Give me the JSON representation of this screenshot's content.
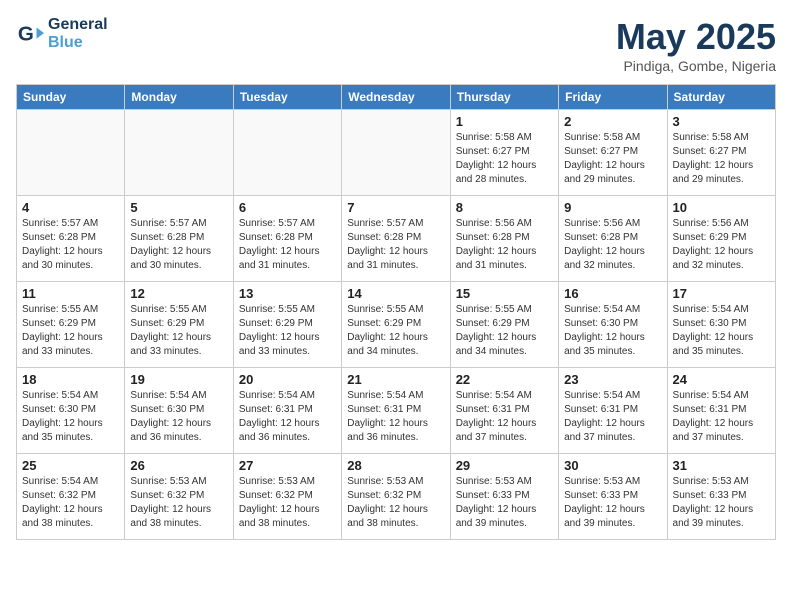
{
  "logo": {
    "line1": "General",
    "line2": "Blue"
  },
  "title": "May 2025",
  "location": "Pindiga, Gombe, Nigeria",
  "weekdays": [
    "Sunday",
    "Monday",
    "Tuesday",
    "Wednesday",
    "Thursday",
    "Friday",
    "Saturday"
  ],
  "weeks": [
    [
      {
        "day": "",
        "info": ""
      },
      {
        "day": "",
        "info": ""
      },
      {
        "day": "",
        "info": ""
      },
      {
        "day": "",
        "info": ""
      },
      {
        "day": "1",
        "info": "Sunrise: 5:58 AM\nSunset: 6:27 PM\nDaylight: 12 hours\nand 28 minutes."
      },
      {
        "day": "2",
        "info": "Sunrise: 5:58 AM\nSunset: 6:27 PM\nDaylight: 12 hours\nand 29 minutes."
      },
      {
        "day": "3",
        "info": "Sunrise: 5:58 AM\nSunset: 6:27 PM\nDaylight: 12 hours\nand 29 minutes."
      }
    ],
    [
      {
        "day": "4",
        "info": "Sunrise: 5:57 AM\nSunset: 6:28 PM\nDaylight: 12 hours\nand 30 minutes."
      },
      {
        "day": "5",
        "info": "Sunrise: 5:57 AM\nSunset: 6:28 PM\nDaylight: 12 hours\nand 30 minutes."
      },
      {
        "day": "6",
        "info": "Sunrise: 5:57 AM\nSunset: 6:28 PM\nDaylight: 12 hours\nand 31 minutes."
      },
      {
        "day": "7",
        "info": "Sunrise: 5:57 AM\nSunset: 6:28 PM\nDaylight: 12 hours\nand 31 minutes."
      },
      {
        "day": "8",
        "info": "Sunrise: 5:56 AM\nSunset: 6:28 PM\nDaylight: 12 hours\nand 31 minutes."
      },
      {
        "day": "9",
        "info": "Sunrise: 5:56 AM\nSunset: 6:28 PM\nDaylight: 12 hours\nand 32 minutes."
      },
      {
        "day": "10",
        "info": "Sunrise: 5:56 AM\nSunset: 6:29 PM\nDaylight: 12 hours\nand 32 minutes."
      }
    ],
    [
      {
        "day": "11",
        "info": "Sunrise: 5:55 AM\nSunset: 6:29 PM\nDaylight: 12 hours\nand 33 minutes."
      },
      {
        "day": "12",
        "info": "Sunrise: 5:55 AM\nSunset: 6:29 PM\nDaylight: 12 hours\nand 33 minutes."
      },
      {
        "day": "13",
        "info": "Sunrise: 5:55 AM\nSunset: 6:29 PM\nDaylight: 12 hours\nand 33 minutes."
      },
      {
        "day": "14",
        "info": "Sunrise: 5:55 AM\nSunset: 6:29 PM\nDaylight: 12 hours\nand 34 minutes."
      },
      {
        "day": "15",
        "info": "Sunrise: 5:55 AM\nSunset: 6:29 PM\nDaylight: 12 hours\nand 34 minutes."
      },
      {
        "day": "16",
        "info": "Sunrise: 5:54 AM\nSunset: 6:30 PM\nDaylight: 12 hours\nand 35 minutes."
      },
      {
        "day": "17",
        "info": "Sunrise: 5:54 AM\nSunset: 6:30 PM\nDaylight: 12 hours\nand 35 minutes."
      }
    ],
    [
      {
        "day": "18",
        "info": "Sunrise: 5:54 AM\nSunset: 6:30 PM\nDaylight: 12 hours\nand 35 minutes."
      },
      {
        "day": "19",
        "info": "Sunrise: 5:54 AM\nSunset: 6:30 PM\nDaylight: 12 hours\nand 36 minutes."
      },
      {
        "day": "20",
        "info": "Sunrise: 5:54 AM\nSunset: 6:31 PM\nDaylight: 12 hours\nand 36 minutes."
      },
      {
        "day": "21",
        "info": "Sunrise: 5:54 AM\nSunset: 6:31 PM\nDaylight: 12 hours\nand 36 minutes."
      },
      {
        "day": "22",
        "info": "Sunrise: 5:54 AM\nSunset: 6:31 PM\nDaylight: 12 hours\nand 37 minutes."
      },
      {
        "day": "23",
        "info": "Sunrise: 5:54 AM\nSunset: 6:31 PM\nDaylight: 12 hours\nand 37 minutes."
      },
      {
        "day": "24",
        "info": "Sunrise: 5:54 AM\nSunset: 6:31 PM\nDaylight: 12 hours\nand 37 minutes."
      }
    ],
    [
      {
        "day": "25",
        "info": "Sunrise: 5:54 AM\nSunset: 6:32 PM\nDaylight: 12 hours\nand 38 minutes."
      },
      {
        "day": "26",
        "info": "Sunrise: 5:53 AM\nSunset: 6:32 PM\nDaylight: 12 hours\nand 38 minutes."
      },
      {
        "day": "27",
        "info": "Sunrise: 5:53 AM\nSunset: 6:32 PM\nDaylight: 12 hours\nand 38 minutes."
      },
      {
        "day": "28",
        "info": "Sunrise: 5:53 AM\nSunset: 6:32 PM\nDaylight: 12 hours\nand 38 minutes."
      },
      {
        "day": "29",
        "info": "Sunrise: 5:53 AM\nSunset: 6:33 PM\nDaylight: 12 hours\nand 39 minutes."
      },
      {
        "day": "30",
        "info": "Sunrise: 5:53 AM\nSunset: 6:33 PM\nDaylight: 12 hours\nand 39 minutes."
      },
      {
        "day": "31",
        "info": "Sunrise: 5:53 AM\nSunset: 6:33 PM\nDaylight: 12 hours\nand 39 minutes."
      }
    ]
  ]
}
